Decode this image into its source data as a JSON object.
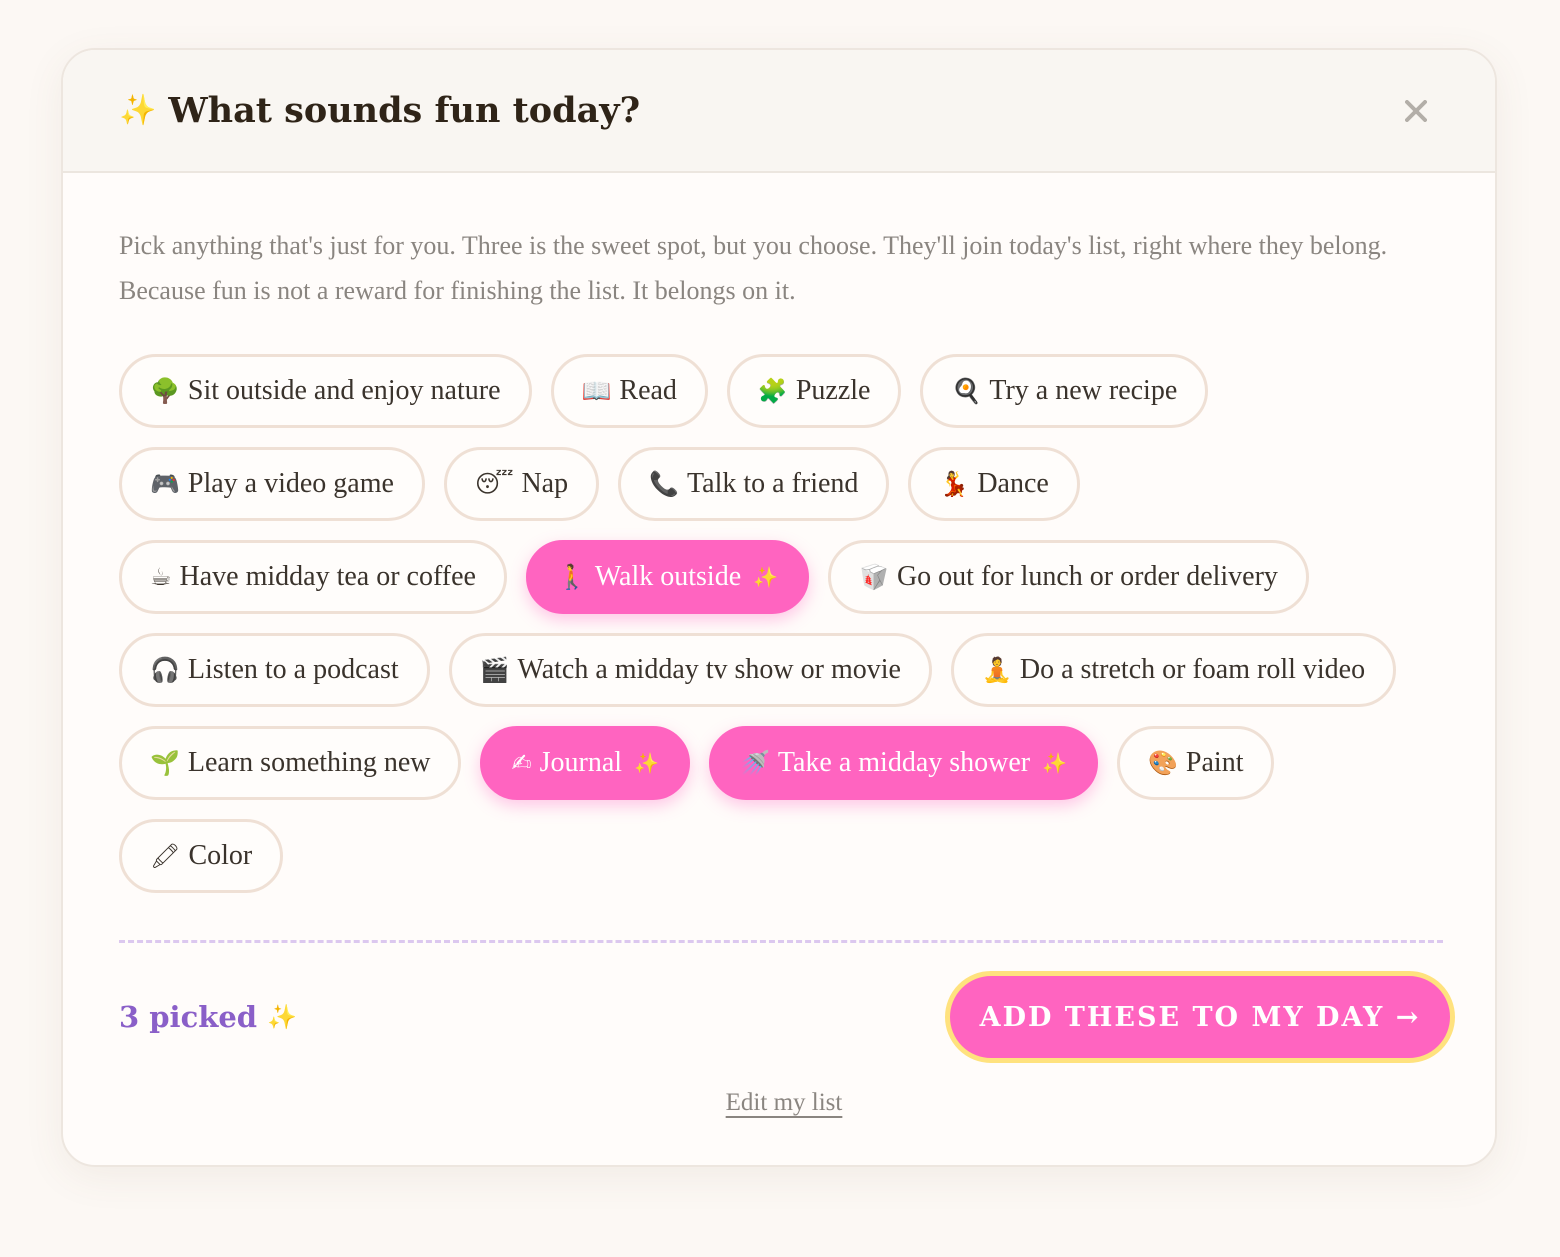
{
  "header": {
    "sparkle": "✨",
    "title": "What sounds fun today?",
    "close_icon": "close-icon"
  },
  "intro": "Pick anything that's just for you. Three is the sweet spot, but you choose. They'll join today's list, right where they belong. Because fun is not a reward for finishing the list. It belongs on it.",
  "activities": [
    {
      "emoji": "🌳",
      "label": "Sit outside and enjoy nature",
      "selected": false,
      "icon": "tree-icon"
    },
    {
      "emoji": "📖",
      "label": "Read",
      "selected": false,
      "icon": "book-icon"
    },
    {
      "emoji": "🧩",
      "label": "Puzzle",
      "selected": false,
      "icon": "puzzle-icon"
    },
    {
      "emoji": "🍳",
      "label": "Try a new recipe",
      "selected": false,
      "icon": "frying-pan-icon"
    },
    {
      "emoji": "🎮",
      "label": "Play a video game",
      "selected": false,
      "icon": "game-controller-icon"
    },
    {
      "emoji": "😴",
      "label": "Nap",
      "selected": false,
      "icon": "sleeping-face-icon"
    },
    {
      "emoji": "📞",
      "label": "Talk to a friend",
      "selected": false,
      "icon": "phone-icon"
    },
    {
      "emoji": "💃",
      "label": "Dance",
      "selected": false,
      "icon": "dancer-icon"
    },
    {
      "emoji": "☕",
      "label": "Have midday tea or coffee",
      "selected": false,
      "icon": "coffee-icon"
    },
    {
      "emoji": "🚶",
      "label": "Walk outside",
      "selected": true,
      "icon": "walking-person-icon"
    },
    {
      "emoji": "🥡",
      "label": "Go out for lunch or order delivery",
      "selected": false,
      "icon": "takeout-box-icon"
    },
    {
      "emoji": "🎧",
      "label": "Listen to a podcast",
      "selected": false,
      "icon": "headphones-icon"
    },
    {
      "emoji": "🎬",
      "label": "Watch a midday tv show or movie",
      "selected": false,
      "icon": "clapper-board-icon"
    },
    {
      "emoji": "🧘",
      "label": "Do a stretch or foam roll video",
      "selected": false,
      "icon": "meditation-icon"
    },
    {
      "emoji": "🌱",
      "label": "Learn something new",
      "selected": false,
      "icon": "seedling-icon"
    },
    {
      "emoji": "✍",
      "label": "Journal",
      "selected": true,
      "icon": "writing-hand-icon"
    },
    {
      "emoji": "🚿",
      "label": "Take a midday shower",
      "selected": true,
      "icon": "shower-icon"
    },
    {
      "emoji": "🎨",
      "label": "Paint",
      "selected": false,
      "icon": "palette-icon"
    },
    {
      "emoji": "🖍",
      "label": "Color",
      "selected": false,
      "icon": "crayon-icon"
    }
  ],
  "selected_sparkle": "✨",
  "footer": {
    "picked_label": "3 picked",
    "picked_sparkle": "✨",
    "add_button_label": "ADD THESE TO MY DAY →",
    "edit_link_label": "Edit my list"
  },
  "colors": {
    "accent_pink": "#ff64c0",
    "button_border_yellow": "#ffe27e",
    "picked_purple": "#8a5fc8",
    "divider_lavender": "#dcc8ef"
  }
}
